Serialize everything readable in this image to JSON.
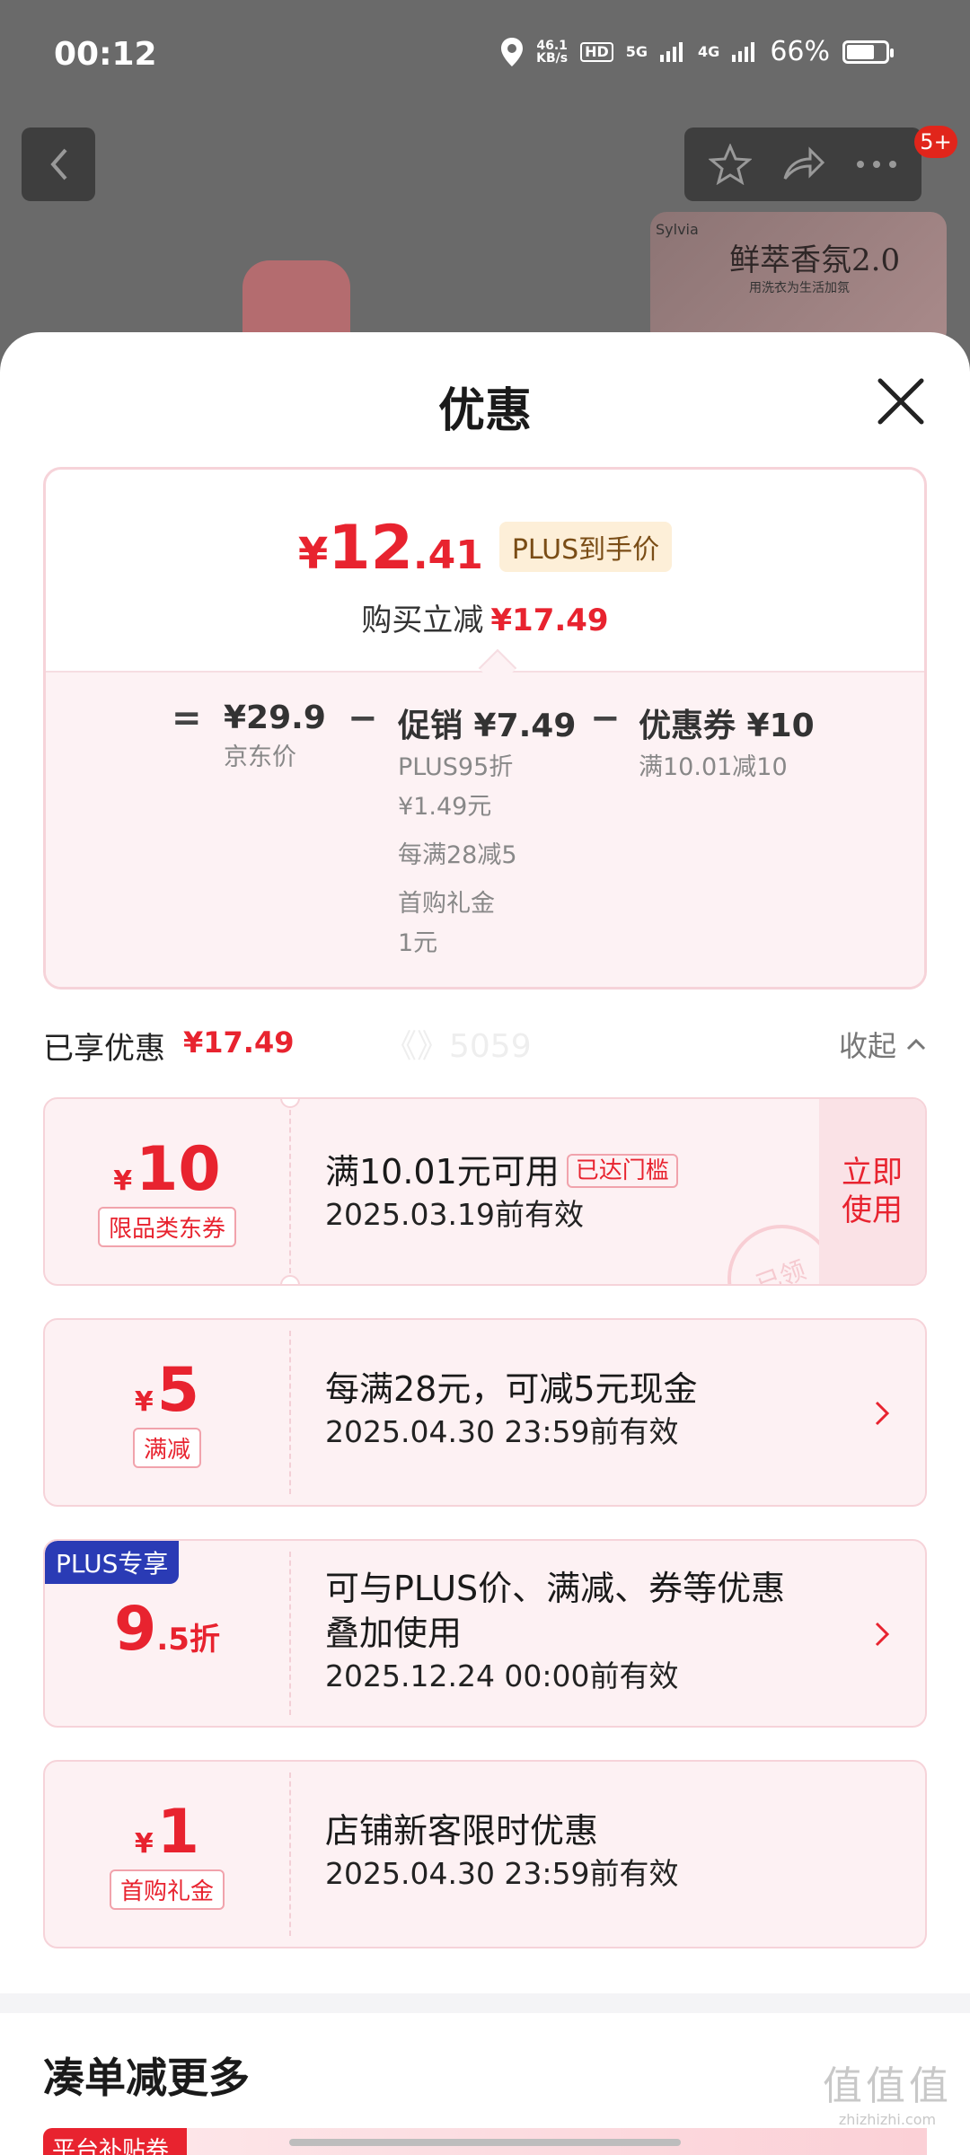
{
  "status_bar": {
    "time": "00:12",
    "net_speed_top": "46.1",
    "net_speed_unit": "KB/s",
    "hd_label": "HD",
    "net_5g": "5G",
    "net_4g": "4G",
    "battery": "66%"
  },
  "background": {
    "badge": "5+",
    "banner_brand": "Sylvia",
    "banner_title": "鲜萃香氛2.0",
    "banner_sub": "用洗衣为生活加氛"
  },
  "sheet": {
    "title": "优惠"
  },
  "summary": {
    "final_currency": "¥",
    "final_int": "12",
    "final_dec": ".41",
    "plus_tag": "PLUS到手价",
    "reduce_label": "购买立减",
    "reduce_amount": "¥17.49",
    "eq": "=",
    "minus": "−",
    "jd_price": "¥29.9",
    "jd_label": "京东价",
    "promo_title": "促销 ¥7.49",
    "promo_items": [
      "PLUS95折",
      "¥1.49元",
      "每满28减5",
      "首购礼金",
      "1元"
    ],
    "coupon_title": "优惠券 ¥10",
    "coupon_sub": "满10.01减10"
  },
  "enjoyed": {
    "label": "已享优惠",
    "amount": "¥17.49",
    "watermark": "《》5059",
    "collapse": "收起"
  },
  "coupons": [
    {
      "yen": "¥",
      "amount": "10",
      "tag": "限品类东券",
      "line1": "满10.01元可用",
      "reach_tag": "已达门槛",
      "line2": "2025.03.19前有效",
      "action_line1": "立即",
      "action_line2": "使用",
      "stamp": "已领"
    },
    {
      "yen": "¥",
      "amount": "5",
      "tag": "满减",
      "line1": "每满28元，可减5元现金",
      "line2": "2025.04.30 23:59前有效"
    },
    {
      "ribbon": "PLUS专享",
      "amount": "9",
      "suffix": ".5折",
      "line1": "可与PLUS价、满减、券等优惠",
      "line1b": "叠加使用",
      "line2": "2025.12.24 00:00前有效"
    },
    {
      "yen": "¥",
      "amount": "1",
      "tag": "首购礼金",
      "line1": "店铺新客限时优惠",
      "line2": "2025.04.30 23:59前有效"
    }
  ],
  "more": {
    "title": "凑单减更多",
    "tag": "平台补贴券"
  },
  "site_mark": {
    "text1": "值值值",
    "text2": "zhizhizhi.com"
  },
  "colors": {
    "accent_red": "#e8232f",
    "plus_blue": "#2a3bb5",
    "plus_gold_bg": "#fdefd8"
  }
}
